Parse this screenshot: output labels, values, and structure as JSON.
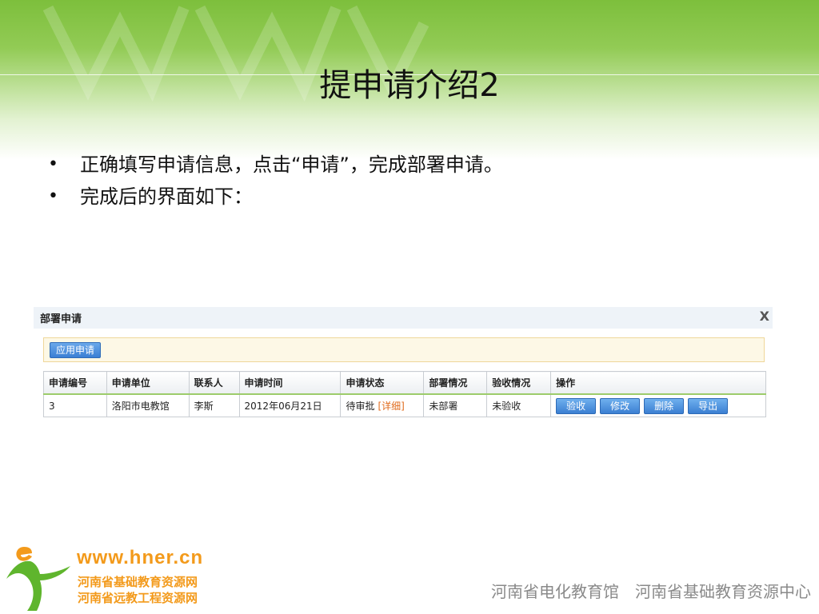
{
  "slide": {
    "title": "提申请介绍2",
    "bullets": [
      "正确填写申请信息，点击“申请”，完成部署申请。",
      "完成后的界面如下："
    ]
  },
  "dialog": {
    "title": "部署申请",
    "close_label": "X",
    "apply_button": "应用申请",
    "columns": [
      "申请编号",
      "申请单位",
      "联系人",
      "申请时间",
      "申请状态",
      "部署情况",
      "验收情况",
      "操作"
    ],
    "rows": [
      {
        "id": "3",
        "unit": "洛阳市电教馆",
        "contact": "李斯",
        "time": "2012年06月21日",
        "status": "待审批",
        "detail_link": "[详细]",
        "deploy": "未部署",
        "accept": "未验收",
        "actions": [
          "验收",
          "修改",
          "删除",
          "导出"
        ]
      }
    ]
  },
  "footer": {
    "url": "www.hner.cn",
    "org_line1": "河南省基础教育资源网",
    "org_line2": "河南省远教工程资源网",
    "right_org1": "河南省电化教育馆",
    "right_org2": "河南省基础教育资源中心"
  },
  "colors": {
    "banner_green": "#7dbf3c",
    "button_blue": "#3a7fd4",
    "detail_orange": "#e06a1b",
    "logo_orange": "#f39a1b",
    "logo_green": "#5fb52d"
  }
}
